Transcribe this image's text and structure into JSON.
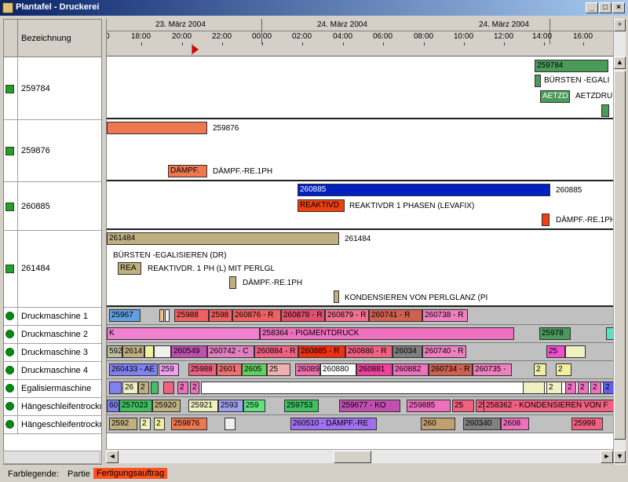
{
  "window": {
    "title": "Plantafel - Druckerei"
  },
  "left": {
    "header": "Bezeichnung",
    "rows": [
      {
        "name": "259784",
        "icon": "document-icon"
      },
      {
        "name": "259876",
        "icon": "document-icon"
      },
      {
        "name": "260885",
        "icon": "document-icon"
      },
      {
        "name": "261484",
        "icon": "document-icon"
      },
      {
        "name": "Druckmaschine 1",
        "icon": "gear-icon"
      },
      {
        "name": "Druckmaschine 2",
        "icon": "gear-icon"
      },
      {
        "name": "Druckmaschine 3",
        "icon": "gear-icon"
      },
      {
        "name": "Druckmaschine 4",
        "icon": "gear-icon"
      },
      {
        "name": "Egalisiermaschine",
        "icon": "gear-icon"
      },
      {
        "name": "Hängeschleifentrockn",
        "icon": "gear-icon"
      },
      {
        "name": "Hängeschleifentrockn",
        "icon": "gear-icon"
      }
    ]
  },
  "timeline": {
    "days": [
      "23. März 2004",
      "24. März 2004",
      "24. März 2004"
    ],
    "hours": [
      "18:00",
      "20:00",
      "22:00",
      "00:00",
      "02:00",
      "04:00",
      "06:00",
      "08:00",
      "10:00",
      "12:00",
      "14:00",
      "16:00"
    ]
  },
  "orders": {
    "r259784": {
      "bar": "259784",
      "l1": "BÜRSTEN -EGALI",
      "l2": "AETZD",
      "l3": "AETZDRU"
    },
    "r259876": {
      "bar_label": "259876",
      "l1": "DÄMPF.",
      "l1t": "DÄMPF.-RE.1PH"
    },
    "r260885": {
      "bar": "260885",
      "bar_label": "260885",
      "l1": "REAKTIVD",
      "l1t": "REAKTIVDR 1 PHASEN (LEVAFIX)",
      "l2t": "DÄMPF.-RE.1PH"
    },
    "r261484": {
      "bar": "261484",
      "bar_label": "261484",
      "l1t": "BÜRSTEN -EGALISIEREN (DR)",
      "l2": "REA",
      "l2t": "REAKTIVDR. 1 PH (L) MIT PERLGL",
      "l3t": "DÄMPF.-RE.1PH",
      "l4t": "KONDENSIEREN VON PERLGLANZ (PI"
    }
  },
  "machines": {
    "dm1": [
      "25967",
      "25988",
      "2598",
      "260876 - R",
      "260878 - R",
      "260879 - R",
      "260741 - R",
      "260738 - R"
    ],
    "dm2": [
      "K",
      "258364 - PIGMENTDRUCK",
      "25978"
    ],
    "dm3": [
      "592",
      "2614",
      "260549",
      "260742 - C",
      "260884 - R",
      "260885 - R",
      "260886 - R",
      "26034",
      "260740 - R",
      "25"
    ],
    "dm4": [
      "260433 - AE",
      "259",
      "25988",
      "2601",
      "2605",
      "25"
    ],
    "dm4b": [
      "26089",
      "260880",
      "260881",
      "260882",
      "260734 - R",
      "260735 -",
      "2",
      "2"
    ],
    "egal": [
      "26",
      "2",
      "2",
      "2",
      "2",
      "2",
      "2",
      "2",
      "2"
    ],
    "h1": [
      "60",
      "257023",
      "25920",
      "25921",
      "2593",
      "259",
      "259753",
      "259677 - KO",
      "259885",
      "25",
      "25",
      "258362 - KONDENSIEREN VON F"
    ],
    "h2": [
      "2592",
      "2",
      "2",
      "259876",
      "260510 - DÄMPF.-RE",
      "260",
      "260340",
      "2608",
      "25999"
    ]
  },
  "status": {
    "legend": "Farblegende:",
    "partie": "Partie",
    "auftrag": "Fertigungsauftrag"
  }
}
